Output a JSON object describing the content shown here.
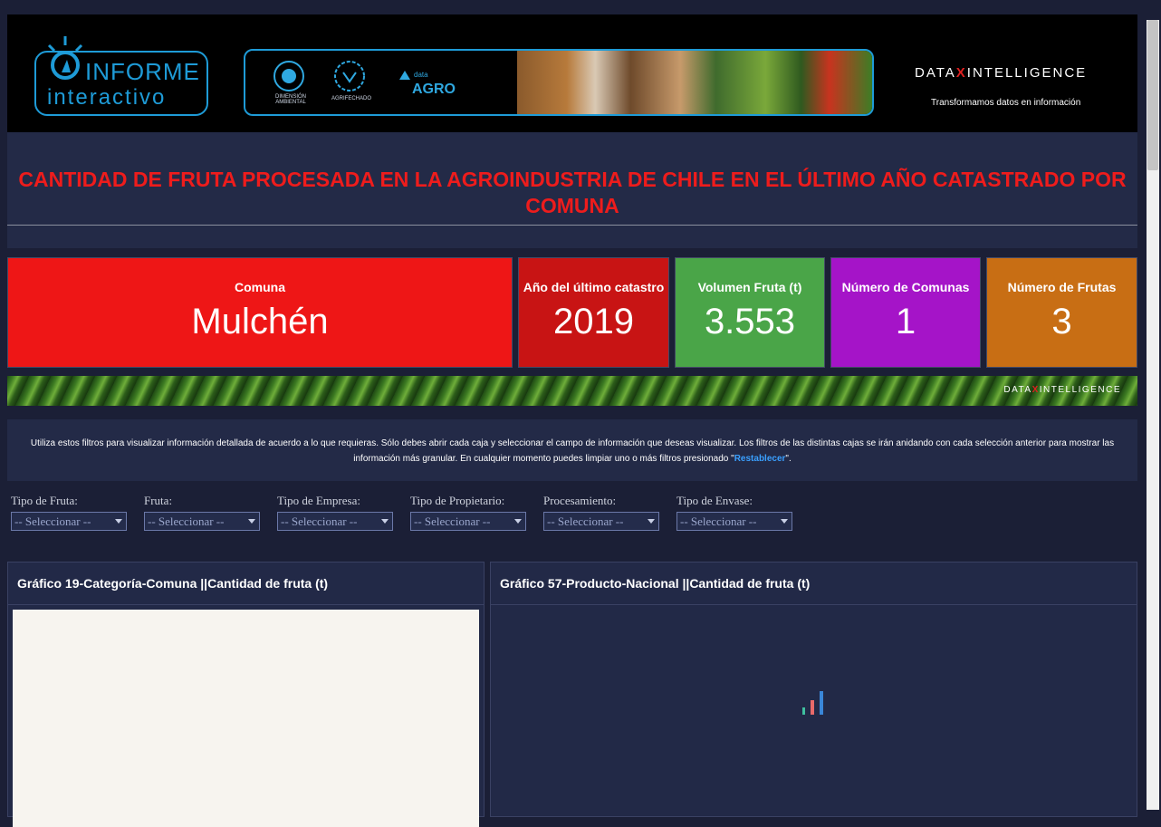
{
  "header": {
    "informe_line1": "INFORME",
    "informe_line2": "interactivo",
    "partners": [
      {
        "label": "DIMENSIÓN AMBIENTAL"
      },
      {
        "label": "AGRIFECHADO"
      }
    ],
    "dataagro_small": "data",
    "dataagro_big": "AGRO",
    "di_left": "DATA",
    "di_right": "INTELLIGENCE",
    "di_tagline": "Transformamos datos en información"
  },
  "title": "CANTIDAD DE FRUTA PROCESADA EN LA AGROINDUSTRIA DE CHILE EN EL ÚLTIMO AÑO CATASTRADO POR COMUNA",
  "kpis": [
    {
      "label": "Comuna",
      "value": "Mulchén",
      "color": "#ee1616"
    },
    {
      "label": "Año del último catastro",
      "value": "2019",
      "color": "#c81414"
    },
    {
      "label": "Volumen Fruta (t)",
      "value": "3.553",
      "color": "#4aa548"
    },
    {
      "label": "Número de Comunas",
      "value": "1",
      "color": "#a514c8"
    },
    {
      "label": "Número de Frutas",
      "value": "3",
      "color": "#c86e14"
    }
  ],
  "leaves_logo": {
    "left": "DATA",
    "right": "INTELLIGENCE"
  },
  "info": {
    "text": "Utiliza estos filtros para visualizar información detallada de acuerdo a lo que requieras. Sólo debes abrir cada caja y seleccionar el campo de información que deseas visualizar. Los filtros de las distintas cajas se irán anidando con cada selección anterior para mostrar las información más granular. En cualquier momento puedes limpiar uno o más filtros presionado \"",
    "link": "Restablecer",
    "tail": "\"."
  },
  "filters": [
    {
      "label": "Tipo de Fruta:",
      "value": "-- Seleccionar --"
    },
    {
      "label": "Fruta:",
      "value": "-- Seleccionar --"
    },
    {
      "label": "Tipo de Empresa:",
      "value": "-- Seleccionar --"
    },
    {
      "label": "Tipo de Propietario:",
      "value": "-- Seleccionar --"
    },
    {
      "label": "Procesamiento:",
      "value": "-- Seleccionar --"
    },
    {
      "label": "Tipo de Envase:",
      "value": "-- Seleccionar --"
    }
  ],
  "panels": [
    {
      "title": "Gráfico 19-Categoría-Comuna ||Cantidad de fruta (t)"
    },
    {
      "title": "Gráfico 57-Producto-Nacional ||Cantidad de fruta (t)"
    }
  ],
  "colors": {
    "background": "#1b1f36",
    "panel": "#232a47",
    "title_red": "#ee1c1c",
    "accent_blue": "#1e9bd7",
    "link_blue": "#3aa0ff"
  }
}
